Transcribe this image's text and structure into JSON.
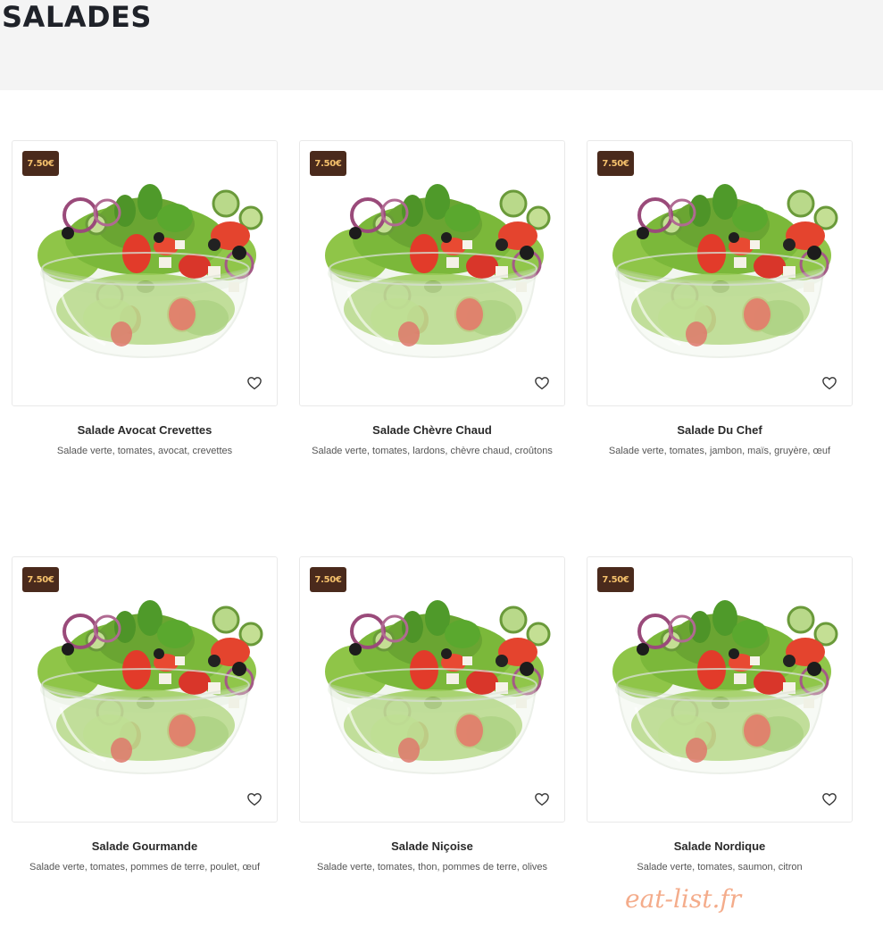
{
  "page": {
    "title": "SALADES"
  },
  "products": [
    {
      "price": "7.50€",
      "name": "Salade Avocat Crevettes",
      "description": "Salade verte, tomates, avocat, crevettes",
      "image": "salad-bowl-image",
      "favorite_icon": "heart-icon"
    },
    {
      "price": "7.50€",
      "name": "Salade Chèvre Chaud",
      "description": "Salade verte, tomates, lardons, chèvre chaud, croûtons",
      "image": "salad-bowl-image",
      "favorite_icon": "heart-icon"
    },
    {
      "price": "7.50€",
      "name": "Salade Du Chef",
      "description": "Salade verte, tomates, jambon, maïs, gruyère, œuf",
      "image": "salad-bowl-image",
      "favorite_icon": "heart-icon"
    },
    {
      "price": "7.50€",
      "name": "Salade Gourmande",
      "description": "Salade verte, tomates, pommes de terre, poulet, œuf",
      "image": "salad-bowl-image",
      "favorite_icon": "heart-icon"
    },
    {
      "price": "7.50€",
      "name": "Salade Niçoise",
      "description": "Salade verte, tomates, thon, pommes de terre, olives",
      "image": "salad-bowl-image",
      "favorite_icon": "heart-icon"
    },
    {
      "price": "7.50€",
      "name": "Salade Nordique",
      "description": "Salade verte, tomates, saumon, citron",
      "image": "salad-bowl-image",
      "favorite_icon": "heart-icon"
    }
  ],
  "watermark": "eat-list.fr",
  "colors": {
    "badge_bg": "#4a2a1c",
    "badge_text": "#f5c16c",
    "header_band": "#f4f4f4",
    "watermark": "#f3a47f"
  }
}
